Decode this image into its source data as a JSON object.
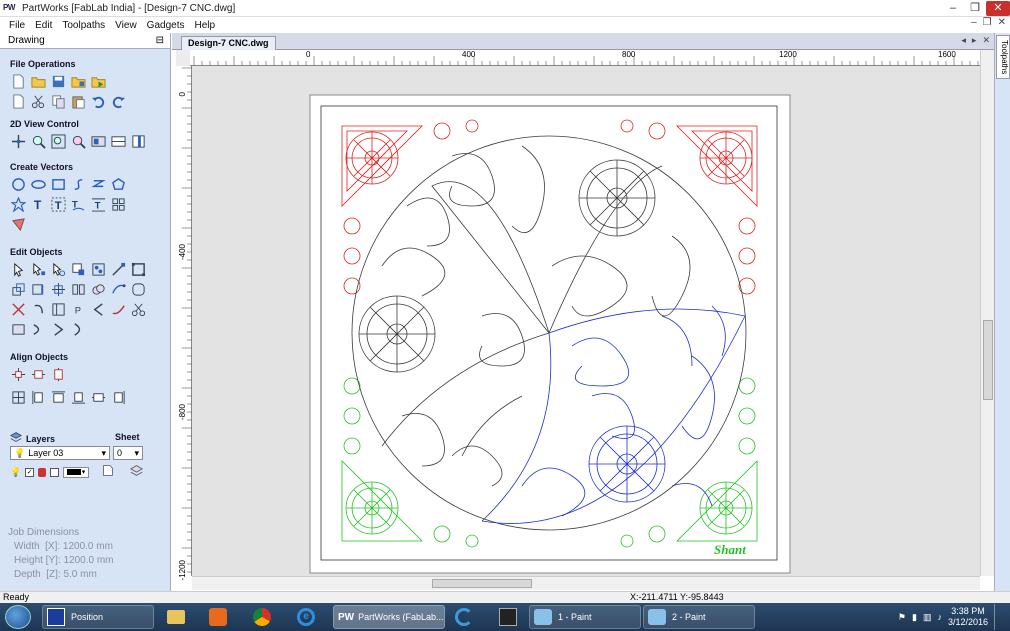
{
  "window": {
    "title": "PartWorks [FabLab India] - [Design-7 CNC.dwg]",
    "logo": "PW",
    "controls": [
      "minimize-icon",
      "restore-icon",
      "close-icon"
    ]
  },
  "menu": [
    "File",
    "Edit",
    "Toolpaths",
    "View",
    "Gadgets",
    "Help"
  ],
  "panel": {
    "title": "Drawing",
    "pin": "⊟",
    "sections": {
      "file": "File Operations",
      "view": "2D View Control",
      "create": "Create Vectors",
      "edit": "Edit Objects",
      "align": "Align Objects"
    },
    "layers_label": "Layers",
    "sheet_label": "Sheet",
    "layer_value": "Layer 03",
    "sheet_value": "0",
    "job": {
      "title": "Job Dimensions",
      "width": "Width  [X]: 1200.0 mm",
      "height": "Height [Y]: 1200.0 mm",
      "depth": "Depth  [Z]: 5.0 mm"
    }
  },
  "document": {
    "tab": "Design-7 CNC.dwg",
    "right_tab": "Toolpaths",
    "ruler_x": [
      "0",
      "400",
      "800",
      "1200",
      "1600"
    ],
    "ruler_y": [
      "0",
      "-400",
      "-800",
      "-1200"
    ]
  },
  "design": {
    "signature": "Shant",
    "colors": {
      "black": "#3a3a3a",
      "red": "#e02020",
      "green": "#22c422",
      "blue": "#1f2fd0"
    }
  },
  "status": {
    "left": "Ready",
    "coords": "X:-211.4711 Y:-95.8443"
  },
  "taskbar": {
    "items": [
      "Position",
      "PartWorks (FabLab...",
      "1 - Paint",
      "2 - Paint"
    ],
    "time": "3:38 PM",
    "date": "3/12/2016"
  }
}
